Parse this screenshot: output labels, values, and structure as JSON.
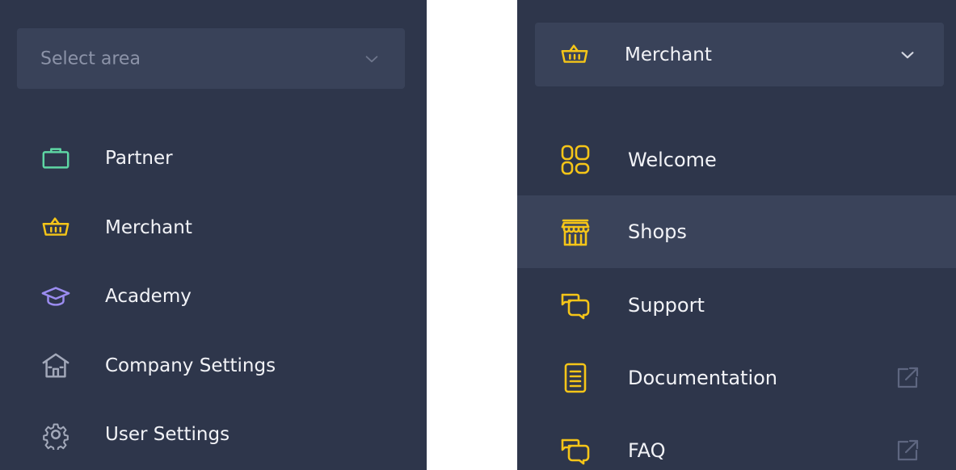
{
  "left_panel": {
    "select": {
      "placeholder": "Select area",
      "icon": "chevron-down-icon"
    },
    "items": [
      {
        "label": "Partner",
        "icon": "briefcase-icon",
        "color": "#5ed7a4"
      },
      {
        "label": "Merchant",
        "icon": "basket-icon",
        "color": "#f5c518"
      },
      {
        "label": "Academy",
        "icon": "graduation-cap-icon",
        "color": "#9b8cf0"
      },
      {
        "label": "Company Settings",
        "icon": "building-icon",
        "color": "#a3a9ba"
      },
      {
        "label": "User Settings",
        "icon": "gear-icon",
        "color": "#a3a9ba"
      }
    ]
  },
  "right_panel": {
    "select": {
      "selected": "Merchant",
      "icon": "basket-icon",
      "color": "#f5c518"
    },
    "active_item": "Shops",
    "items": [
      {
        "label": "Welcome",
        "icon": "dashboard-icon",
        "color": "#f5c518",
        "external": false
      },
      {
        "label": "Shops",
        "icon": "shop-icon",
        "color": "#f5c518",
        "external": false
      },
      {
        "label": "Support",
        "icon": "chat-icon",
        "color": "#f5c518",
        "external": false
      },
      {
        "label": "Documentation",
        "icon": "document-icon",
        "color": "#f5c518",
        "external": true
      },
      {
        "label": "FAQ",
        "icon": "chat-icon",
        "color": "#f5c518",
        "external": true
      }
    ]
  },
  "colors": {
    "panel_bg": "#2e364b",
    "select_bg": "#394259",
    "active_bg": "#3a435a",
    "text": "#f2f3f7",
    "placeholder": "#8c93a8",
    "accent": "#f5c518"
  }
}
